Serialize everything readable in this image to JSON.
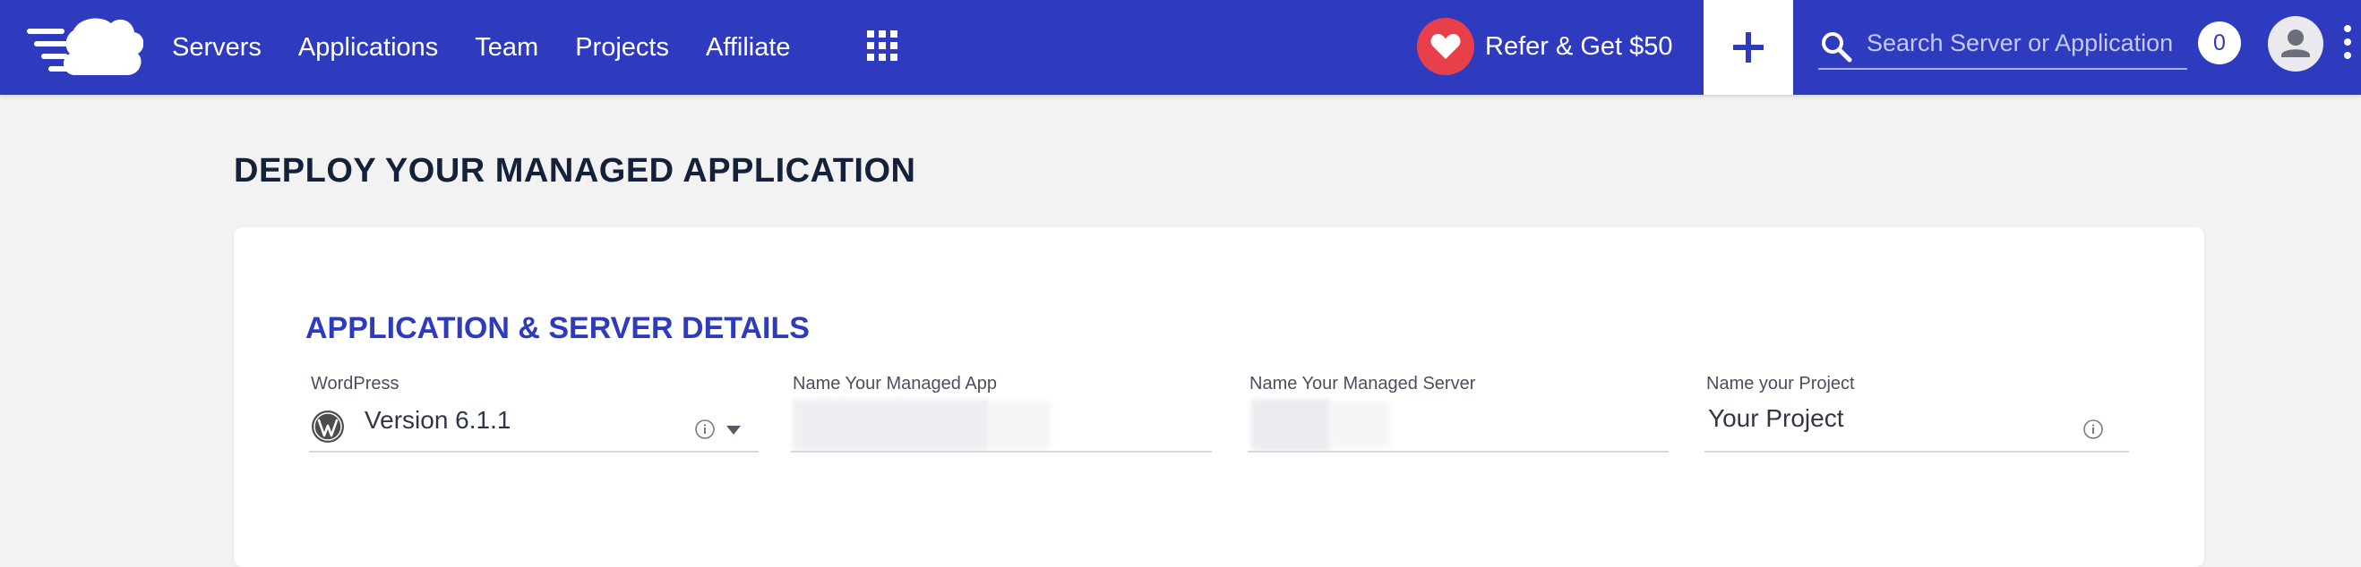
{
  "nav": {
    "items": [
      {
        "label": "Servers"
      },
      {
        "label": "Applications"
      },
      {
        "label": "Team"
      },
      {
        "label": "Projects"
      },
      {
        "label": "Affiliate"
      }
    ]
  },
  "refer": {
    "label": "Refer & Get $50"
  },
  "search": {
    "placeholder": "Search Server or Application"
  },
  "notifications": {
    "count": "0"
  },
  "page": {
    "title": "DEPLOY YOUR MANAGED APPLICATION"
  },
  "section": {
    "title": "APPLICATION & SERVER DETAILS"
  },
  "fields": {
    "application": {
      "label": "WordPress",
      "value": "Version 6.1.1"
    },
    "app_name": {
      "label": "Name Your Managed App",
      "value": ""
    },
    "server_name": {
      "label": "Name Your Managed Server",
      "value": ""
    },
    "project": {
      "label": "Name your Project",
      "value": "Your Project"
    }
  },
  "colors": {
    "brand": "#2f3bbf",
    "accent_red": "#e8404a",
    "background": "#f2f2f2"
  },
  "icons": {
    "logo": "cloudways-cloud-logo",
    "apps": "grid-icon",
    "refer": "heart-icon",
    "add": "plus-icon",
    "search": "search-icon",
    "avatar": "user-icon",
    "menu": "kebab-menu-icon",
    "wordpress": "wordpress-icon",
    "info": "info-icon",
    "dropdown": "caret-down-icon"
  }
}
